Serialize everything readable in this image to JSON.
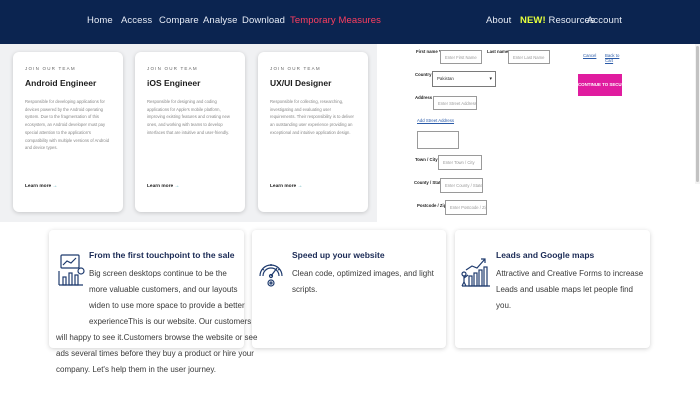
{
  "nav": {
    "left": [
      "Home",
      "Access",
      "Compare",
      "Analyse",
      "Download",
      "Temporary Measures"
    ],
    "about": "About",
    "new_badge": "NEW!",
    "resources": "Resources",
    "account": "Account",
    "active_color": "#ff3e5f"
  },
  "jobs": [
    {
      "eyebrow": "JOIN OUR TEAM",
      "title": "Android Engineer",
      "desc": "Responsible for developing applications for devices powered by the Android operating system. Due to the fragmentation of this ecosystem, an Android developer must pay special attention to the application's compatibility with multiple versions of Android and device types.",
      "link": "Learn more",
      "arrow": "→"
    },
    {
      "eyebrow": "JOIN OUR TEAM",
      "title": "iOS Engineer",
      "desc": "Responsible for designing and coding applications for Apple's mobile platform, improving existing features and creating new ones, and working with teams to develop interfaces that are intuitive and user-friendly.",
      "link": "Learn more",
      "arrow": "→"
    },
    {
      "eyebrow": "JOIN OUR TEAM",
      "title": "UX/UI Designer",
      "desc": "Responsible for collecting, researching, investigating and evaluating user requirements. Their responsibility is to deliver an outstanding user experience providing an exceptional and intuitive application design.",
      "link": "Learn more",
      "arrow": "→"
    }
  ],
  "form": {
    "first_name_label": "First name *",
    "first_name_placeholder": "Enter First Name",
    "last_name_label": "Last name *",
    "last_name_placeholder": "Enter Last Name",
    "country_label": "Country",
    "country_value": "Pakistan",
    "address_label": "Address *",
    "address_placeholder": "Enter Street Address",
    "add_street_link": "Add Street Address",
    "town_label": "Town / City *",
    "town_placeholder": "Enter Town / City",
    "county_label": "County / State",
    "county_placeholder": "Enter County / State",
    "postcode_label": "Postcode / Zip",
    "postcode_placeholder": "Enter Postcode / Zip",
    "submit_label": "CONTINUE TO SECURE PAY",
    "side_links": [
      "Cancel",
      "Back to Cart"
    ],
    "accent": "#e01c9f"
  },
  "features": [
    {
      "icon": "chart-analytics-icon",
      "title": "From the first touchpoint to the sale",
      "lines": [
        "Big screen desktops continue to be the",
        "more valuable customers, and our layouts",
        "widen to use more space to provide a better",
        "experienceThis is our website. Our customers",
        "will happy to see it.Customers browse the website or see",
        "ads several times before they buy a product or hire your",
        "company. Let's help them in the user journey."
      ]
    },
    {
      "icon": "speedometer-gear-icon",
      "title": "Speed up your website",
      "lines": [
        "Clean code, optimized images, and light",
        "scripts."
      ]
    },
    {
      "icon": "growth-chart-person-icon",
      "title": "Leads and Google maps",
      "lines": [
        "Attractive and Creative Forms to increase",
        "Leads and usable maps let people find you."
      ]
    }
  ]
}
